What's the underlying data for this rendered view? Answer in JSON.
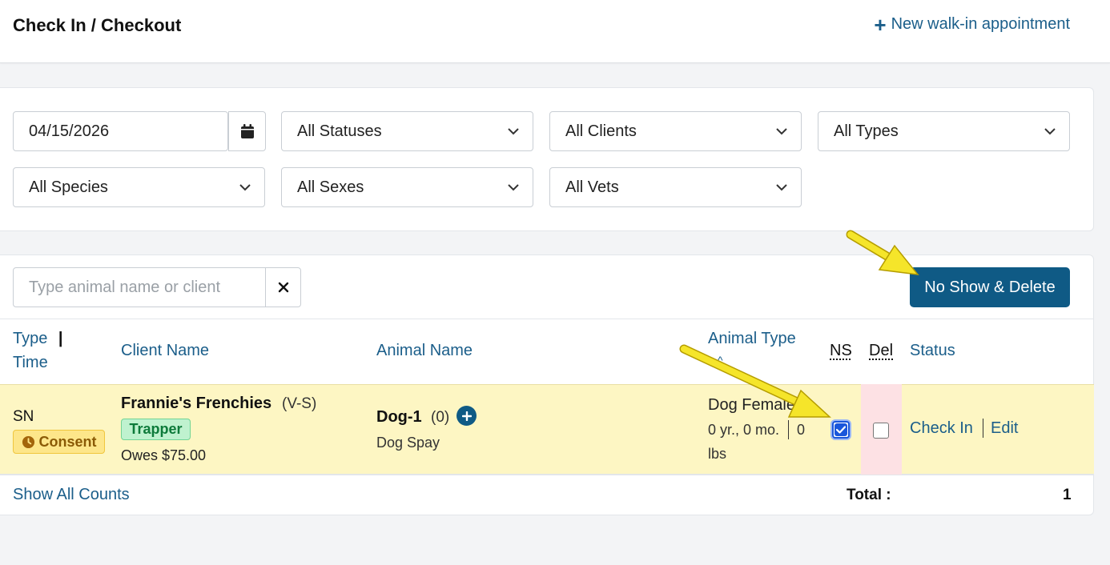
{
  "header": {
    "title": "Check In / Checkout",
    "new_walkin_label": "New walk-in appointment"
  },
  "filters": {
    "date": "04/15/2026",
    "status": "All Statuses",
    "clients": "All Clients",
    "types": "All Types",
    "species": "All Species",
    "sexes": "All Sexes",
    "vets": "All Vets"
  },
  "search": {
    "placeholder": "Type animal name or client"
  },
  "actions": {
    "no_show_delete_label": "No Show & Delete"
  },
  "table": {
    "headers": {
      "type": "Type",
      "divider": "|",
      "time": "Time",
      "client_name": "Client Name",
      "animal_name": "Animal Name",
      "animal_type": "Animal Type",
      "animal_type_sort": "^",
      "ns": "NS",
      "del": "Del",
      "status": "Status"
    },
    "rows": [
      {
        "type": "SN",
        "consent_badge": "Consent",
        "client_name": "Frannie's Frenchies",
        "client_code": "(V-S)",
        "trapper_badge": "Trapper",
        "owes": "Owes $75.00",
        "animal_name": "Dog-1",
        "animal_count": "(0)",
        "procedure": "Dog Spay",
        "animal_type": "Dog Female",
        "age": "0 yr., 0 mo.",
        "weight_value": "0",
        "weight_unit": "lbs",
        "ns_checked": true,
        "del_checked": false,
        "check_in_label": "Check In",
        "edit_label": "Edit"
      }
    ]
  },
  "footer": {
    "show_counts_label": "Show All Counts",
    "total_label": "Total :",
    "total_value": "1"
  },
  "colors": {
    "primary": "#0f5a85",
    "link": "#1b5e8a",
    "row_highlight": "#fdf6c3",
    "del_highlight": "#fde1e4",
    "arrow": "#f5e52a"
  }
}
